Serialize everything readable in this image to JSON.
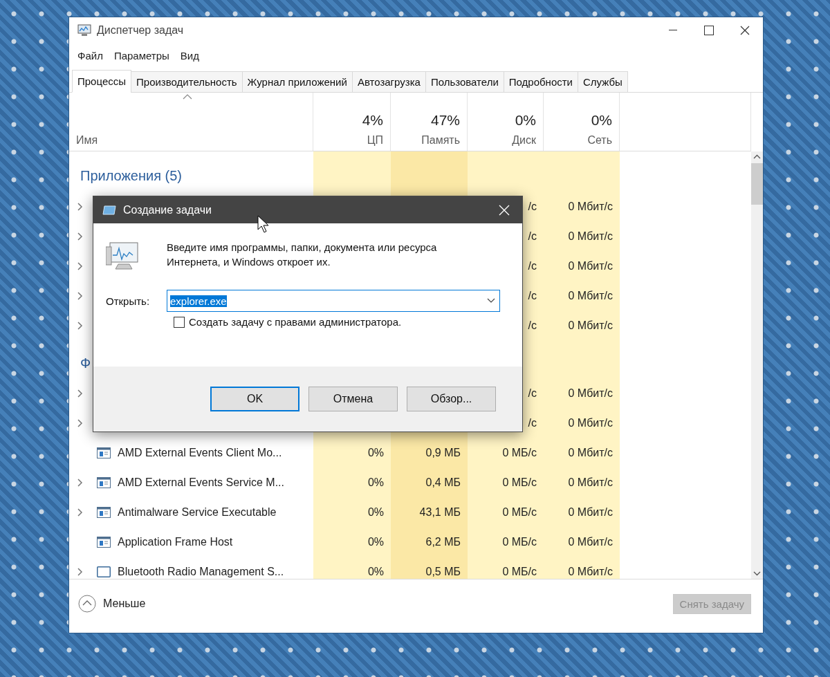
{
  "window": {
    "title": "Диспетчер задач"
  },
  "menu": [
    "Файл",
    "Параметры",
    "Вид"
  ],
  "tabs": [
    {
      "label": "Процессы",
      "selected": true
    },
    {
      "label": "Производительность",
      "selected": false
    },
    {
      "label": "Журнал приложений",
      "selected": false
    },
    {
      "label": "Автозагрузка",
      "selected": false
    },
    {
      "label": "Пользователи",
      "selected": false
    },
    {
      "label": "Подробности",
      "selected": false
    },
    {
      "label": "Службы",
      "selected": false
    }
  ],
  "columns": [
    {
      "label": "Имя",
      "sorted": true
    },
    {
      "total": "4%",
      "label": "ЦП",
      "sorted": false,
      "color": "#fff4c4"
    },
    {
      "total": "47%",
      "label": "Память",
      "sorted": false,
      "color": "#fbe8a6"
    },
    {
      "total": "0%",
      "label": "Диск",
      "sorted": false,
      "color": "#fff4c4"
    },
    {
      "total": "0%",
      "label": "Сеть",
      "sorted": false,
      "color": "#fff4c4"
    }
  ],
  "groups": [
    {
      "title": "Приложения (5)",
      "rows": [
        {
          "expandable": true,
          "disk": "/с",
          "network": "0 Мбит/с"
        },
        {
          "expandable": true,
          "disk": "/с",
          "network": "0 Мбит/с"
        },
        {
          "expandable": true,
          "disk": "/с",
          "network": "0 Мбит/с"
        },
        {
          "expandable": true,
          "disk": "/с",
          "network": "0 Мбит/с"
        },
        {
          "expandable": true,
          "disk": "/с",
          "network": "0 Мбит/с"
        }
      ]
    },
    {
      "title": "Ф",
      "rows": [
        {
          "expandable": true,
          "disk": "/с",
          "network": "0 Мбит/с"
        },
        {
          "expandable": true,
          "disk": "/с",
          "network": "0 Мбит/с"
        },
        {
          "expandable": false,
          "kind": "service",
          "name": "AMD External Events Client Mo...",
          "cpu": "0%",
          "memory": "0,9 МБ",
          "disk": "0 МБ/с",
          "network": "0 Мбит/с"
        },
        {
          "expandable": true,
          "kind": "service",
          "name": "AMD External Events Service M...",
          "cpu": "0%",
          "memory": "0,4 МБ",
          "disk": "0 МБ/с",
          "network": "0 Мбит/с"
        },
        {
          "expandable": true,
          "kind": "service",
          "name": "Antimalware Service Executable",
          "cpu": "0%",
          "memory": "43,1 МБ",
          "disk": "0 МБ/с",
          "network": "0 Мбит/с"
        },
        {
          "expandable": false,
          "kind": "service",
          "name": "Application Frame Host",
          "cpu": "0%",
          "memory": "6,2 МБ",
          "disk": "0 МБ/с",
          "network": "0 Мбит/с"
        },
        {
          "expandable": true,
          "kind": "window",
          "name": "Bluetooth Radio Management S...",
          "cpu": "0%",
          "memory": "0,5 МБ",
          "disk": "0 МБ/с",
          "network": "0 Мбит/с"
        }
      ]
    }
  ],
  "footer": {
    "toggle": "Меньше",
    "end_task": {
      "label": "Снять задачу",
      "disabled": true
    }
  },
  "dialog": {
    "title": "Создание задачи",
    "message": "Введите имя программы, папки, документа или ресурса Интернета, и Windows откроет их.",
    "open_label": "Открыть:",
    "input": {
      "value": "explorer.exe",
      "selected": true
    },
    "admin_checkbox": {
      "label": "Создать задачу с правами администратора.",
      "checked": false
    },
    "buttons": [
      {
        "label": "OK",
        "default": true
      },
      {
        "label": "Отмена",
        "default": false
      },
      {
        "label": "Обзор...",
        "default": false
      }
    ]
  }
}
